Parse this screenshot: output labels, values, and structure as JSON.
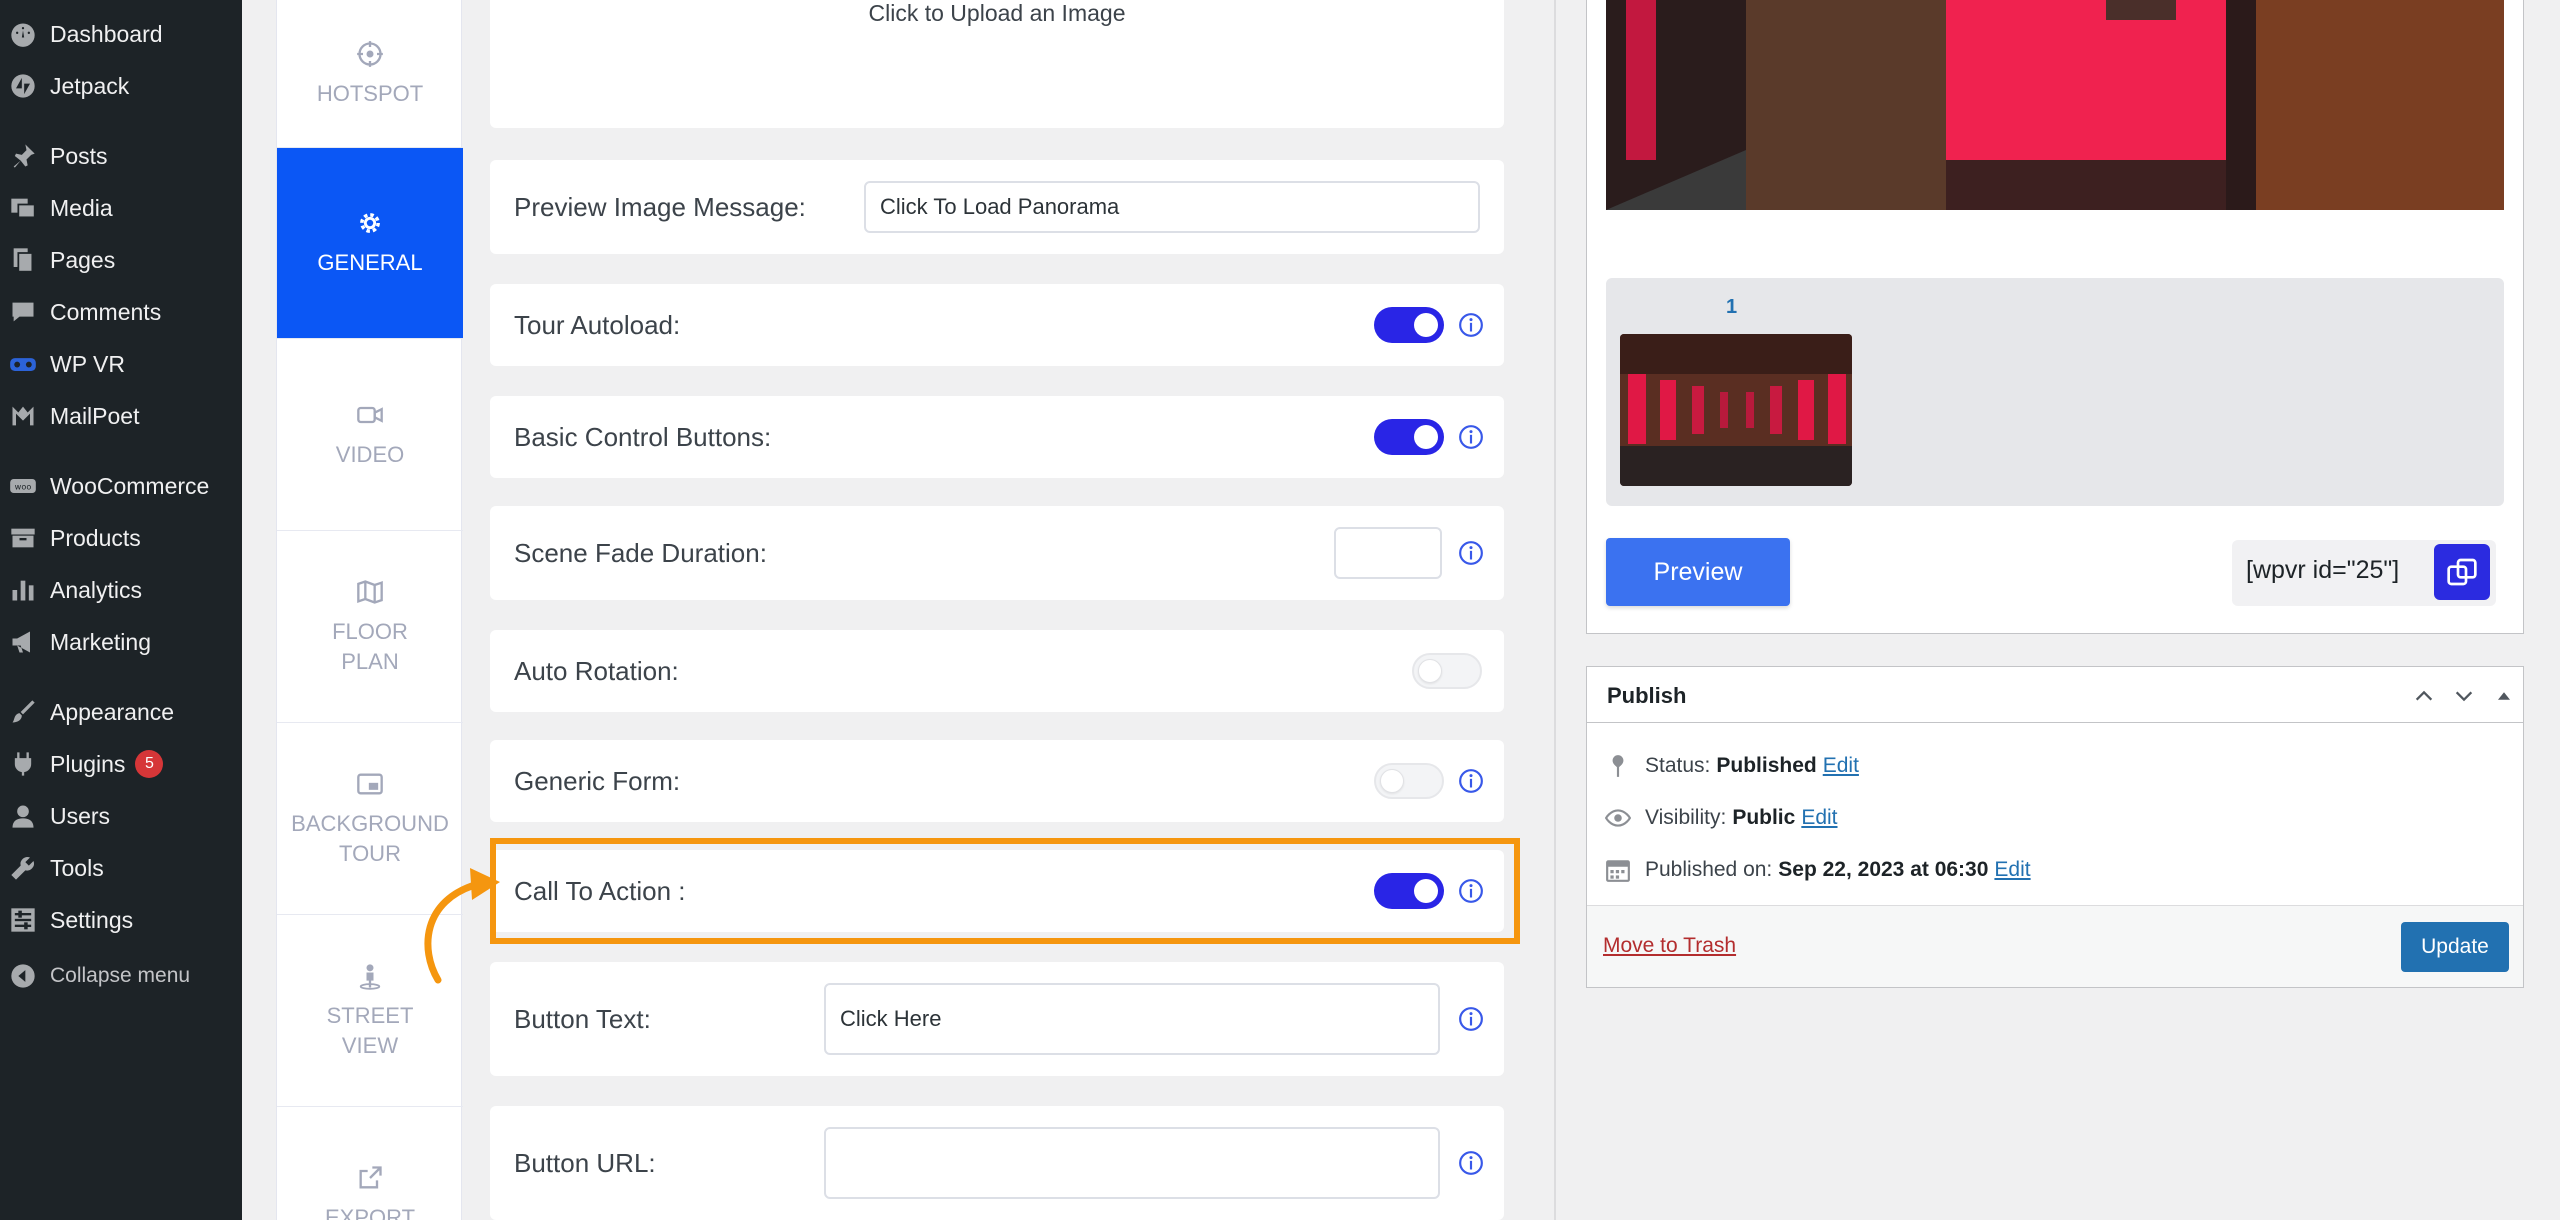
{
  "admin_menu": {
    "items": [
      {
        "label": "Dashboard",
        "icon": "dashboard-icon"
      },
      {
        "label": "Jetpack",
        "icon": "jetpack-icon"
      },
      {
        "label": "Posts",
        "icon": "pin-icon"
      },
      {
        "label": "Media",
        "icon": "media-icon"
      },
      {
        "label": "Pages",
        "icon": "pages-icon"
      },
      {
        "label": "Comments",
        "icon": "comment-icon"
      },
      {
        "label": "WP VR",
        "icon": "vr-icon"
      },
      {
        "label": "MailPoet",
        "icon": "mailpoet-icon"
      },
      {
        "label": "WooCommerce",
        "icon": "woo-icon"
      },
      {
        "label": "Products",
        "icon": "archive-icon"
      },
      {
        "label": "Analytics",
        "icon": "bar-chart-icon"
      },
      {
        "label": "Marketing",
        "icon": "megaphone-icon"
      },
      {
        "label": "Appearance",
        "icon": "brush-icon"
      },
      {
        "label": "Plugins",
        "icon": "plugin-icon",
        "badge": "5"
      },
      {
        "label": "Users",
        "icon": "user-icon"
      },
      {
        "label": "Tools",
        "icon": "wrench-icon"
      },
      {
        "label": "Settings",
        "icon": "sliders-icon"
      },
      {
        "label": "Collapse menu",
        "icon": "collapse-icon"
      }
    ]
  },
  "tabs": {
    "hotspot": "HOTSPOT",
    "general": "GENERAL",
    "video": "VIDEO",
    "floor_plan_1": "FLOOR",
    "floor_plan_2": "PLAN",
    "background_tour_1": "BACKGROUND",
    "background_tour_2": "TOUR",
    "street_view_1": "STREET",
    "street_view_2": "VIEW",
    "export": "EXPORT"
  },
  "settings": {
    "upload_text": "Click to Upload an Image",
    "preview_message_label": "Preview Image Message:",
    "preview_message_value": "Click To Load Panorama",
    "tour_autoload_label": "Tour Autoload:",
    "tour_autoload": true,
    "basic_controls_label": "Basic Control Buttons:",
    "basic_controls": true,
    "scene_fade_label": "Scene Fade Duration:",
    "scene_fade_value": "",
    "auto_rotation_label": "Auto Rotation:",
    "auto_rotation": false,
    "generic_form_label": "Generic Form:",
    "generic_form": false,
    "cta_label": "Call To Action :",
    "cta": true,
    "button_text_label": "Button Text:",
    "button_text_value": "Click Here",
    "button_url_label": "Button URL:",
    "button_url_value": ""
  },
  "tour_preview": {
    "scene_number": "1",
    "preview_label": "Preview",
    "shortcode": "[wpvr id=\"25\"]"
  },
  "publish": {
    "title": "Publish",
    "status_label": "Status:",
    "status_value": "Published",
    "visibility_label": "Visibility:",
    "visibility_value": "Public",
    "published_label": "Published on:",
    "published_value": "Sep 22, 2023 at 06:30",
    "edit_label": "Edit",
    "trash_label": "Move to Trash",
    "update_label": "Update"
  },
  "colors": {
    "accent_blue": "#0b57f5",
    "toggle_on": "#2925e6",
    "highlight": "#f5960f",
    "wp_blue": "#2271b1"
  }
}
